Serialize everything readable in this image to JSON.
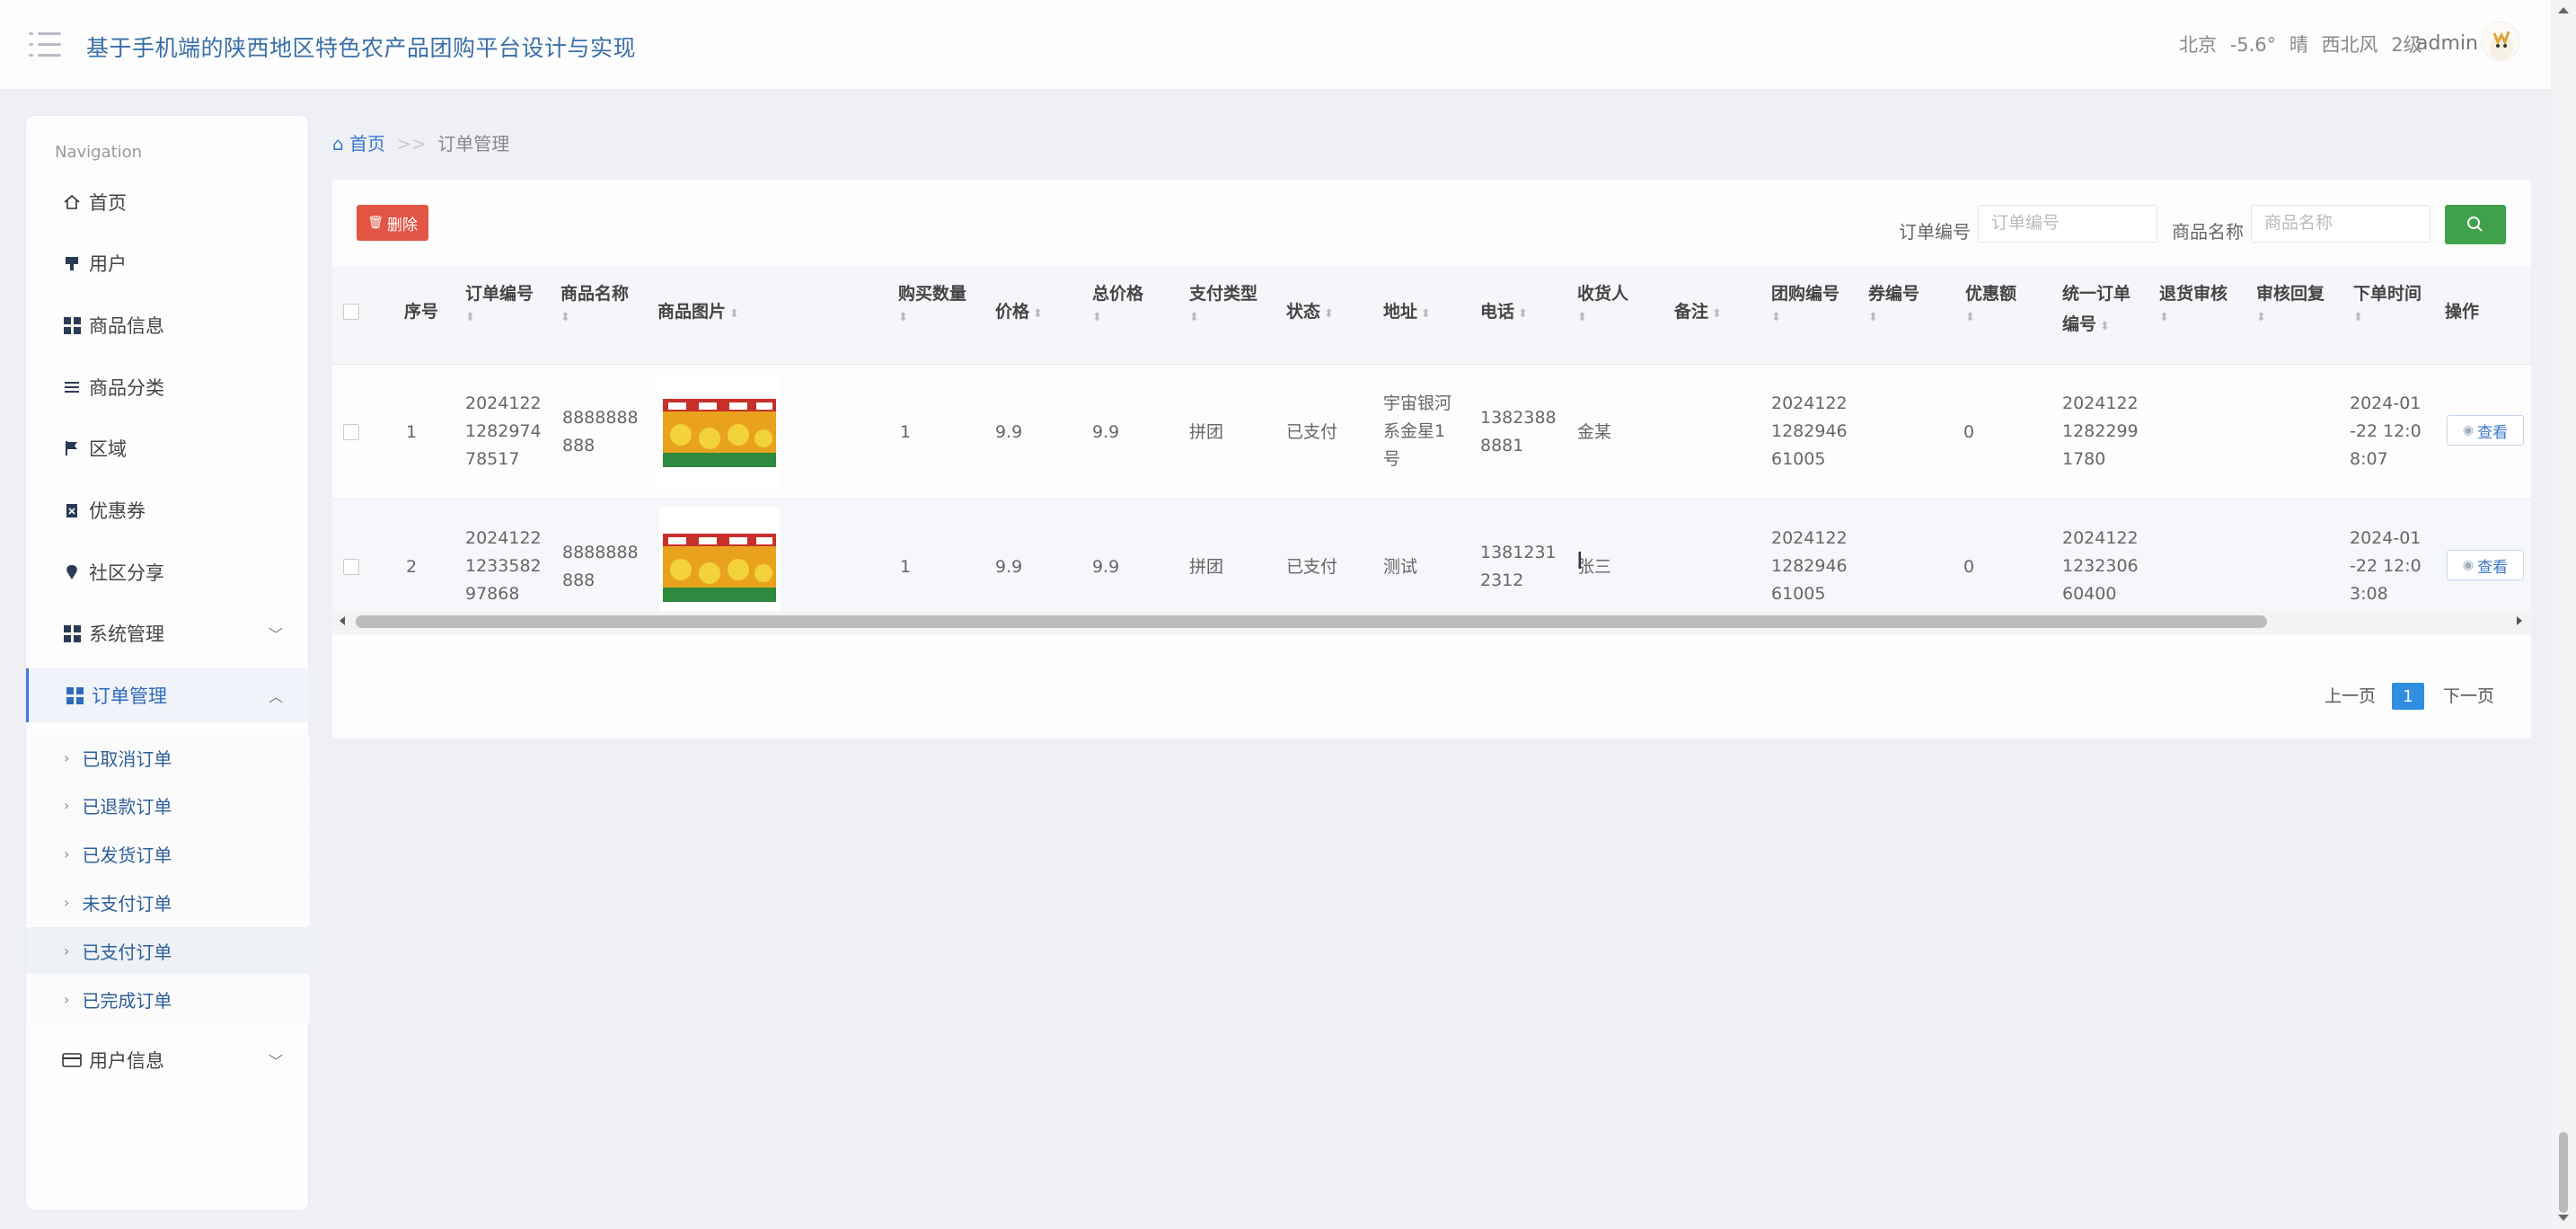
{
  "header": {
    "app_title": "基于手机端的陕西地区特色农产品团购平台设计与实现",
    "weather": {
      "city": "北京",
      "temp": "-5.6°",
      "cond": "晴",
      "wind": "西北风",
      "level": "2级"
    },
    "user": "admin"
  },
  "sidebar": {
    "heading": "Navigation",
    "items": [
      {
        "label": "首页",
        "icon": "home-icon"
      },
      {
        "label": "用户",
        "icon": "user-icon"
      },
      {
        "label": "商品信息",
        "icon": "grid-icon"
      },
      {
        "label": "商品分类",
        "icon": "list-icon"
      },
      {
        "label": "区域",
        "icon": "flag-icon"
      },
      {
        "label": "优惠券",
        "icon": "clipboard-icon"
      },
      {
        "label": "社区分享",
        "icon": "location-icon"
      },
      {
        "label": "系统管理",
        "icon": "grid-icon"
      },
      {
        "label": "订单管理",
        "icon": "grid-icon"
      },
      {
        "label": "用户信息",
        "icon": "card-icon"
      }
    ],
    "order_sub": [
      "已取消订单",
      "已退款订单",
      "已发货订单",
      "未支付订单",
      "已支付订单",
      "已完成订单"
    ]
  },
  "breadcrumb": {
    "home": "首页",
    "separator": ">>",
    "current": "订单管理"
  },
  "toolbar": {
    "delete_label": "删除",
    "order_no_label": "订单编号",
    "order_no_placeholder": "订单编号",
    "goods_name_label": "商品名称",
    "goods_name_placeholder": "商品名称"
  },
  "table": {
    "headers": {
      "index": "序号",
      "order_no": "订单编号",
      "goods_name": "商品名称",
      "goods_image": "商品图片",
      "quantity": "购买数量",
      "price": "价格",
      "total": "总价格",
      "pay_type": "支付类型",
      "status": "状态",
      "address": "地址",
      "phone": "电话",
      "receiver": "收货人",
      "remark": "备注",
      "group_no": "团购编号",
      "coupon_no": "券编号",
      "discount": "优惠额",
      "unified_no_1": "统一订单",
      "unified_no_2": "编号",
      "refund_review": "退货审核",
      "review_reply": "审核回复",
      "order_time": "下单时间",
      "action": "操作"
    },
    "rows": [
      {
        "index": "1",
        "order_no": [
          "2024122",
          "1282974",
          "78517"
        ],
        "goods_name": [
          "8888888",
          "888"
        ],
        "quantity": "1",
        "price": "9.9",
        "total": "9.9",
        "pay_type": "拼团",
        "status": "已支付",
        "address": [
          "宇宙银河",
          "系金星1",
          "号"
        ],
        "phone": [
          "1382388",
          "8881"
        ],
        "receiver": "金某",
        "remark": "",
        "group_no": [
          "2024122",
          "1282946",
          "61005"
        ],
        "coupon_no": "",
        "discount": "0",
        "unified_no": [
          "2024122",
          "1282299",
          "1780"
        ],
        "refund_review": "",
        "review_reply": "",
        "order_time": [
          "2024-01",
          "-22 12:0",
          "8:07"
        ],
        "action": "查看"
      },
      {
        "index": "2",
        "order_no": [
          "2024122",
          "1233582",
          "97868"
        ],
        "goods_name": [
          "8888888",
          "888"
        ],
        "quantity": "1",
        "price": "9.9",
        "total": "9.9",
        "pay_type": "拼团",
        "status": "已支付",
        "address": [
          "测试"
        ],
        "phone": [
          "1381231",
          "2312"
        ],
        "receiver": "张三",
        "remark": "",
        "group_no": [
          "2024122",
          "1282946",
          "61005"
        ],
        "coupon_no": "",
        "discount": "0",
        "unified_no": [
          "2024122",
          "1232306",
          "60400"
        ],
        "refund_review": "",
        "review_reply": "",
        "order_time": [
          "2024-01",
          "-22 12:0",
          "3:08"
        ],
        "action": "查看"
      }
    ]
  },
  "pagination": {
    "prev": "上一页",
    "current": "1",
    "next": "下一页"
  },
  "colors": {
    "accent": "#3a78c8",
    "danger": "#e25545",
    "success": "#3fa24a",
    "page_active": "#2f8ee0"
  }
}
